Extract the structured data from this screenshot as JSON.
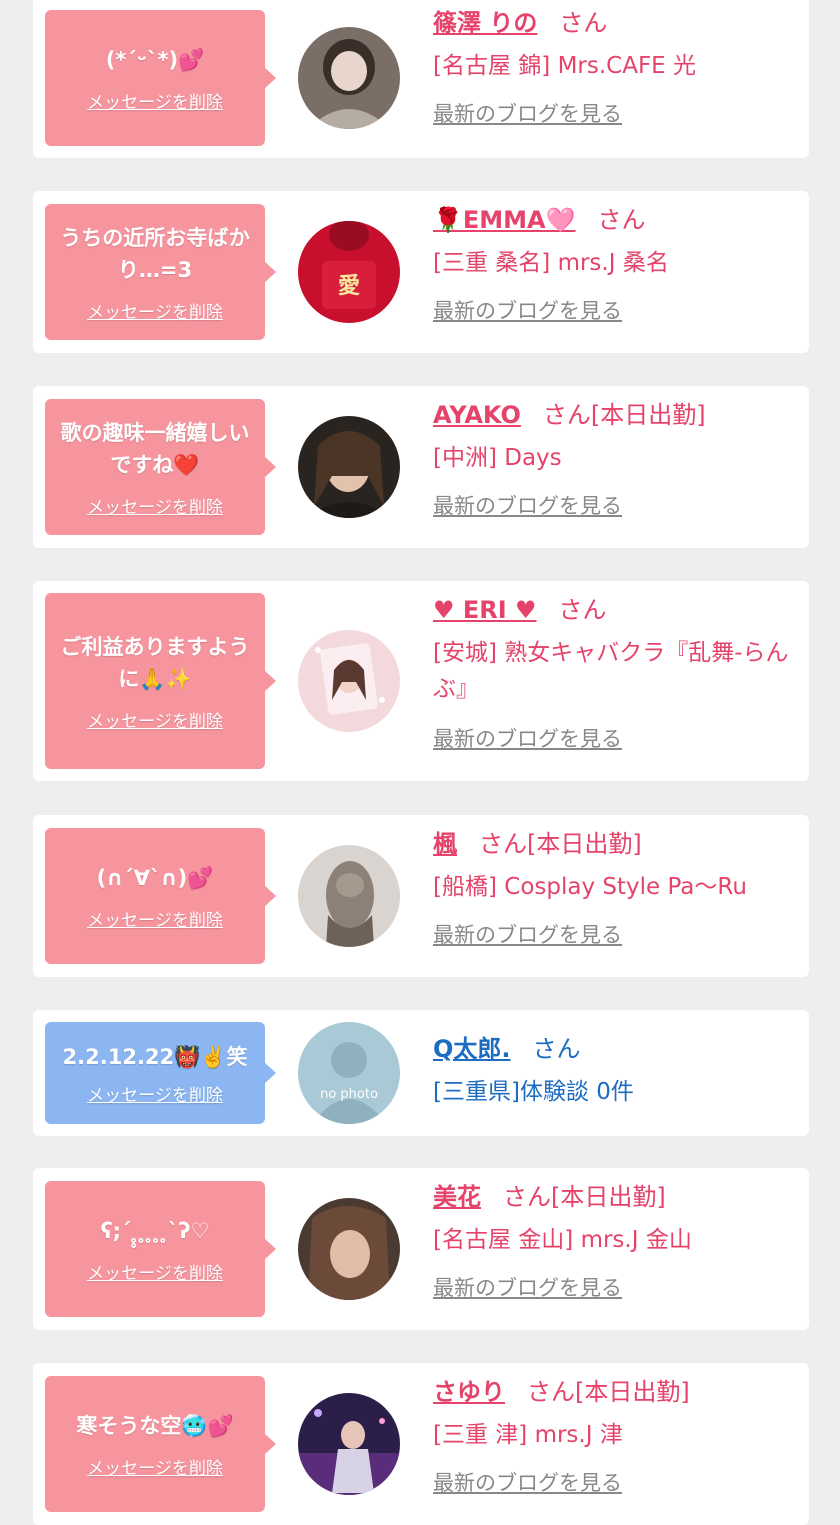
{
  "colors": {
    "bubble_pink": "#f7959f",
    "bubble_blue": "#8bb6f2",
    "name_pink": "#e5436a",
    "name_blue": "#1d6cc2",
    "link_gray": "#888888",
    "card_bg": "#ffffff",
    "page_bg": "#eeeeee"
  },
  "items": [
    {
      "message": "(*´ᵕ`*)💕",
      "delete_label": "メッセージを削除",
      "name": "篠澤 りの",
      "suffix": "さん",
      "shop": "[名古屋 錦] Mrs.CAFE 光",
      "blog_link": "最新のブログを見る",
      "avatar_icon": "woman-photo-avatar"
    },
    {
      "message": "うちの近所お寺ばかり…=3",
      "delete_label": "メッセージを削除",
      "name": "🌹EMMA🩷",
      "suffix": "さん",
      "shop": "[三重 桑名] mrs.J 桑名",
      "blog_link": "最新のブログを見る",
      "avatar_icon": "red-hoodie-avatar"
    },
    {
      "message": "歌の趣味一緒嬉しいですね❤️",
      "delete_label": "メッセージを削除",
      "name": "AYAKO",
      "suffix": "さん[本日出勤]",
      "shop": "[中洲] Days",
      "blog_link": "最新のブログを見る",
      "avatar_icon": "woman-photo-avatar"
    },
    {
      "message": "ご利益ありますように🙏✨",
      "delete_label": "メッセージを削除",
      "name": "♥ ERI ♥",
      "suffix": "さん",
      "shop": "[安城] 熟女キャバクラ『乱舞-らんぶ』",
      "blog_link": "最新のブログを見る",
      "avatar_icon": "woman-photo-avatar"
    },
    {
      "message": "(∩´∀`∩)💕",
      "delete_label": "メッセージを削除",
      "name": "楓",
      "suffix": "さん[本日出勤]",
      "shop": "[船橋] Cosplay Style Pa〜Ru",
      "blog_link": "最新のブログを見る",
      "avatar_icon": "hairstyle-photo-avatar"
    },
    {
      "message": "2.2.12.22👹✌️笑",
      "delete_label": "メッセージを削除",
      "name": "Q太郎.",
      "suffix": "さん",
      "shop": "[三重県]体験談 0件",
      "blog_link": "",
      "avatar_icon": "no-photo-avatar",
      "avatar_text": "no photo"
    },
    {
      "message": "ʕ;´ ̥̥ ̥ ̥ ̥ ̥`ʔ♡",
      "delete_label": "メッセージを削除",
      "name": "美花",
      "suffix": "さん[本日出勤]",
      "shop": "[名古屋 金山] mrs.J 金山",
      "blog_link": "最新のブログを見る",
      "avatar_icon": "woman-photo-avatar"
    },
    {
      "message": "寒そうな空🥶💕",
      "delete_label": "メッセージを削除",
      "name": "さゆり",
      "suffix": "さん[本日出勤]",
      "shop": "[三重 津] mrs.J 津",
      "blog_link": "最新のブログを見る",
      "avatar_icon": "stage-photo-avatar"
    }
  ]
}
